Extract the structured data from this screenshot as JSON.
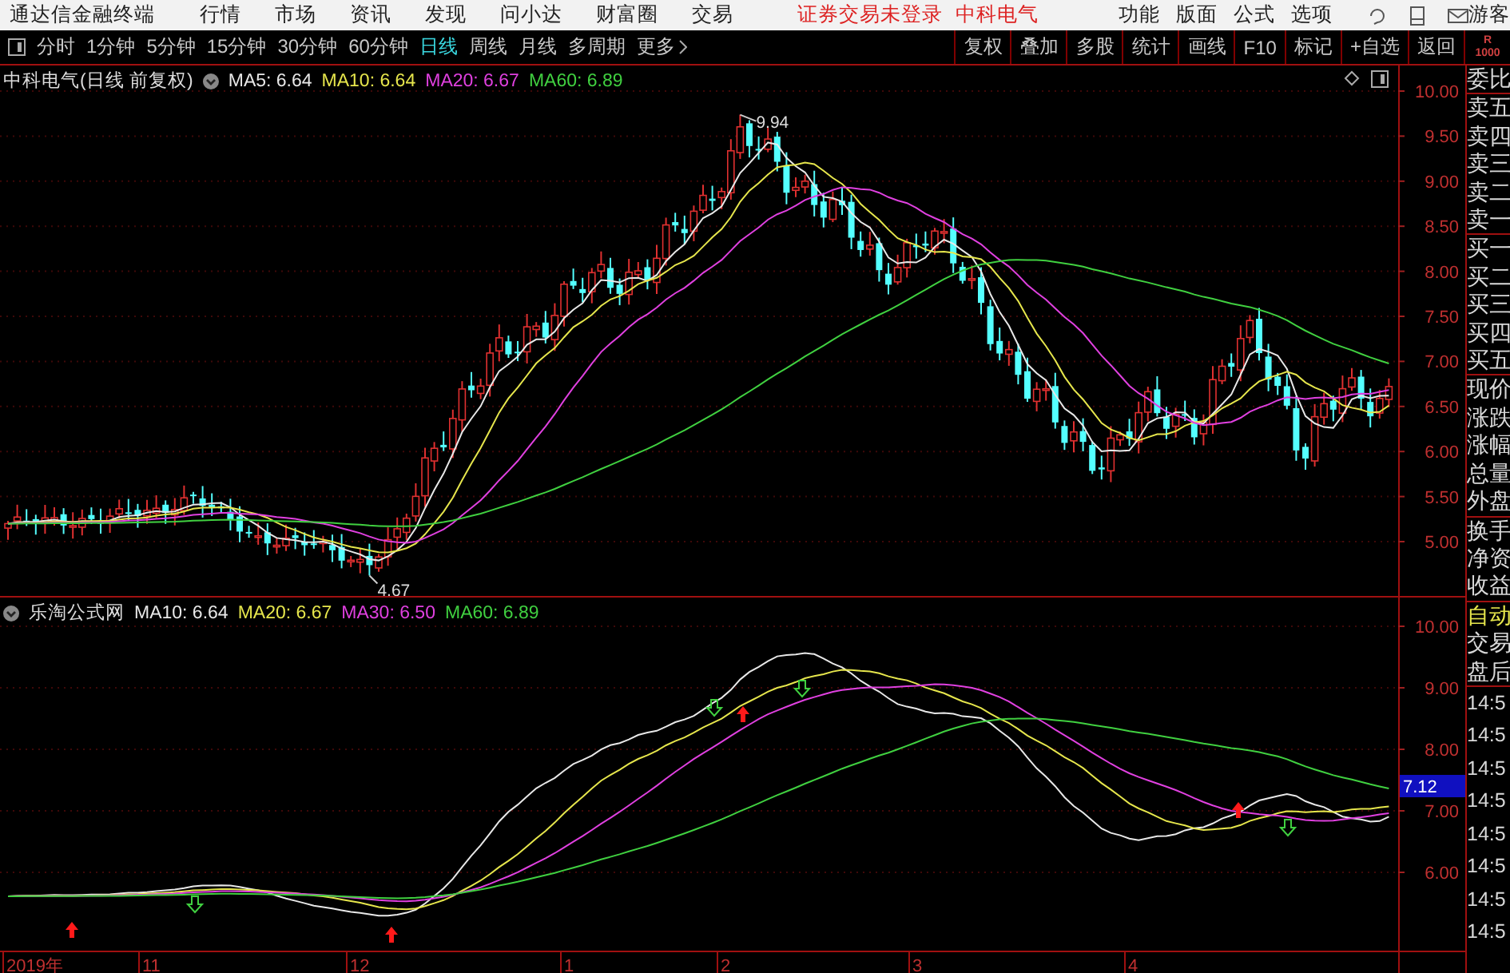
{
  "menubar": {
    "app_title": "通达信金融终端",
    "menus": [
      "行情",
      "市场",
      "资讯",
      "发现",
      "问小达",
      "财富圈",
      "交易"
    ],
    "login_status": "证券交易未登录",
    "stock_name": "中科电气",
    "functions": [
      "功能",
      "版面",
      "公式",
      "选项"
    ],
    "user": "游客"
  },
  "toolbar": {
    "periods": [
      {
        "label": "分时",
        "selected": false
      },
      {
        "label": "1分钟",
        "selected": false
      },
      {
        "label": "5分钟",
        "selected": false
      },
      {
        "label": "15分钟",
        "selected": false
      },
      {
        "label": "30分钟",
        "selected": false
      },
      {
        "label": "60分钟",
        "selected": false
      },
      {
        "label": "日线",
        "selected": true
      },
      {
        "label": "周线",
        "selected": false
      },
      {
        "label": "月线",
        "selected": false
      },
      {
        "label": "多周期",
        "selected": false
      }
    ],
    "more": "更多",
    "actions": [
      "复权",
      "叠加",
      "多股",
      "统计",
      "画线",
      "F10",
      "标记",
      "+自选",
      "返回"
    ],
    "scale_mark": [
      "R",
      "1000"
    ]
  },
  "price_chart": {
    "title": "中科电气(日线 前复权)",
    "legend": [
      {
        "label": "MA5: 6.64",
        "color": "#e8e8e8"
      },
      {
        "label": "MA10: 6.64",
        "color": "#e6e64c"
      },
      {
        "label": "MA20: 6.67",
        "color": "#e040e0"
      },
      {
        "label": "MA60: 6.89",
        "color": "#40d040"
      }
    ],
    "y_axis": [
      "10.00",
      "9.50",
      "9.00",
      "8.50",
      "8.00",
      "7.50",
      "7.00",
      "6.50",
      "6.00",
      "5.50",
      "5.00"
    ],
    "high_label": "9.94",
    "low_label": "4.67"
  },
  "indicator_chart": {
    "title": "乐淘公式网",
    "legend": [
      {
        "label": "MA10: 6.64",
        "color": "#e8e8e8"
      },
      {
        "label": "MA20: 6.67",
        "color": "#e6e64c"
      },
      {
        "label": "MA30: 6.50",
        "color": "#e040e0"
      },
      {
        "label": "MA60: 6.89",
        "color": "#40d040"
      }
    ],
    "y_axis": [
      "10.00",
      "9.00",
      "8.00",
      "7.00",
      "6.00"
    ],
    "current_value": "7.12"
  },
  "x_axis": [
    "2019年",
    "11",
    "12",
    "1",
    "2",
    "3",
    "4"
  ],
  "side_panel": {
    "quote_groups": [
      [
        "委比"
      ],
      [
        "卖五",
        "卖四",
        "卖三",
        "卖二",
        "卖一"
      ],
      [
        "买一",
        "买二",
        "买三",
        "买四",
        "买五"
      ],
      [
        "现价",
        "涨跌",
        "涨幅",
        "总量",
        "外盘"
      ],
      [
        "换手",
        "净资",
        "收益"
      ]
    ],
    "trade_items": [
      {
        "text": "自动",
        "highlighted": true
      },
      {
        "text": "交易",
        "highlighted": false
      },
      {
        "text": "盘后",
        "highlighted": false
      }
    ],
    "times": [
      "14:5",
      "14:5",
      "14:5",
      "14:5",
      "14:5",
      "14:5",
      "14:5",
      "14:5"
    ]
  }
}
